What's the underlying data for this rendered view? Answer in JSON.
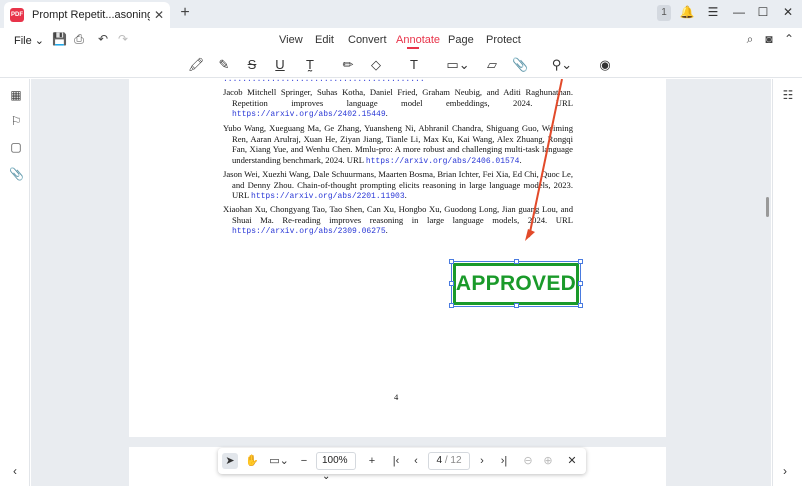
{
  "tab": {
    "title": "Prompt Repetit...asoning LLMs *",
    "close": "✕",
    "new_tab": "+"
  },
  "window": {
    "badge": "1",
    "bell": "🔔",
    "menu": "☰",
    "minimize": "—",
    "maximize": "☐",
    "close": "✕"
  },
  "menubar": {
    "file": "File ⌄",
    "tabs": [
      "View",
      "Edit",
      "Convert",
      "Annotate",
      "Page",
      "Protect"
    ],
    "active_tab": "Annotate"
  },
  "stamp": {
    "text": "APPROVED",
    "color": "#1a9a2a"
  },
  "references": [
    {
      "text": "Jacob Mitchell Springer, Suhas Kotha, Daniel Fried, Graham Neubig, and Aditi Raghunathan. Repetition improves language model embeddings, 2024. URL ",
      "url": "https://arxiv.org/abs/2402.15449",
      "tail": "."
    },
    {
      "text": "Yubo Wang, Xueguang Ma, Ge Zhang, Yuansheng Ni, Abhranil Chandra, Shiguang Guo, Weiming Ren, Aaran Arulraj, Xuan He, Ziyan Jiang, Tianle Li, Max Ku, Kai Wang, Alex Zhuang, Rongqi Fan, Xiang Yue, and Wenhu Chen. Mmlu-pro: A more robust and challenging multi-task language understanding benchmark, 2024. URL ",
      "url": "https://arxiv.org/abs/2406.01574",
      "tail": "."
    },
    {
      "text": "Jason Wei, Xuezhi Wang, Dale Schuurmans, Maarten Bosma, Brian Ichter, Fei Xia, Ed Chi, Quoc Le, and Denny Zhou. Chain-of-thought prompting elicits reasoning in large language models, 2023. URL ",
      "url": "https://arxiv.org/abs/2201.11903",
      "tail": "."
    },
    {
      "text": "Xiaohan Xu, Chongyang Tao, Tao Shen, Can Xu, Hongbo Xu, Guodong Long, Jian guang Lou, and Shuai Ma. Re-reading improves reasoning in large language models, 2024. URL ",
      "url": "https://arxiv.org/abs/2309.06275",
      "tail": "."
    }
  ],
  "page_number": "4",
  "bottombar": {
    "zoom": "100%  ⌄",
    "page_current": "4",
    "page_total": "/ 12"
  }
}
